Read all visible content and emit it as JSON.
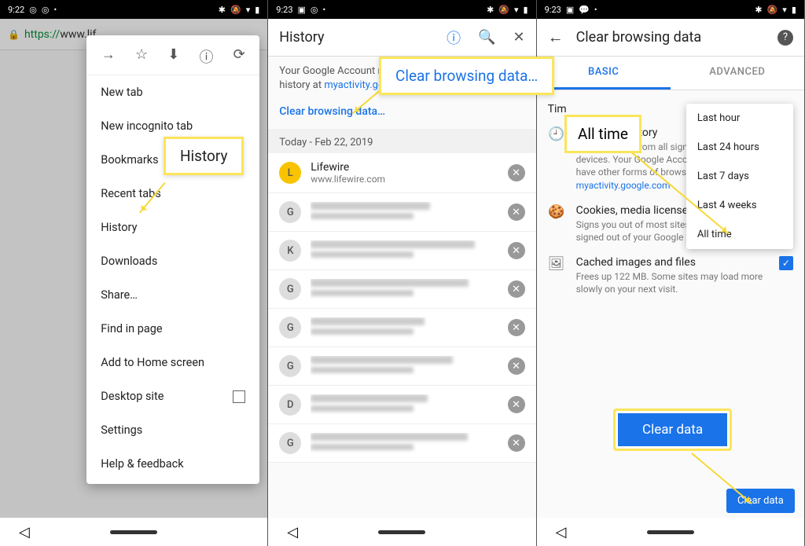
{
  "panel1": {
    "status_time": "9:22",
    "url_prefix": "https://",
    "url_host": "www.lif",
    "menu_top": {
      "forward": "→",
      "star": "☆",
      "download": "⬇",
      "info": "ⓘ",
      "reload": "⟳"
    },
    "menu_items": {
      "new_tab": "New tab",
      "new_incognito": "New incognito tab",
      "bookmarks": "Bookmarks",
      "recent_tabs": "Recent tabs",
      "history": "History",
      "downloads": "Downloads",
      "share": "Share…",
      "find_in_page": "Find in page",
      "add_home": "Add to Home screen",
      "desktop_site": "Desktop site",
      "settings": "Settings",
      "help": "Help & feedback"
    },
    "callout_history": "History"
  },
  "panel2": {
    "status_time": "9:23",
    "title": "History",
    "subtext_1": "Your Google Account m",
    "subtext_2": "history at ",
    "subtext_link": "myactivity.go",
    "clear_link": "Clear browsing data…",
    "date_header": "Today - Feb 22, 2019",
    "items": [
      {
        "fav": "L",
        "title": "Lifewire",
        "url": "www.lifewire.com",
        "favbg": "#f9c300",
        "blurred": false
      },
      {
        "fav": "G",
        "blurred": true
      },
      {
        "fav": "K",
        "blurred": true
      },
      {
        "fav": "G",
        "blurred": true
      },
      {
        "fav": "G",
        "blurred": true
      },
      {
        "fav": "G",
        "blurred": true
      },
      {
        "fav": "D",
        "blurred": true
      },
      {
        "fav": "G",
        "blurred": true
      }
    ],
    "callout_clear": "Clear browsing data…"
  },
  "panel3": {
    "status_time": "9:23",
    "title": "Clear browsing data",
    "tab_basic": "BASIC",
    "tab_advanced": "ADVANCED",
    "time_label_prefix": "Tim",
    "dropdown": [
      "Last hour",
      "Last 24 hours",
      "Last 7 days",
      "Last 4 weeks",
      "All time"
    ],
    "sections": {
      "history": {
        "title": "Browsing history",
        "desc_1": "Clears history from all signed-",
        "desc_2": "devices. Your Google Account",
        "desc_3": "have other forms of browsing",
        "desc_link": "myactivity.google.com"
      },
      "cookies": {
        "title": "Cookies, media licenses an",
        "desc_1": "Signs you out of most sites. Y",
        "desc_2": "signed out of your Google Acc"
      },
      "cache": {
        "title": "Cached images and files",
        "desc": "Frees up 122 MB. Some sites may load more slowly on your next visit."
      }
    },
    "clear_button": "Clear data",
    "callout_alltime": "All time",
    "callout_cleardata": "Clear data"
  }
}
